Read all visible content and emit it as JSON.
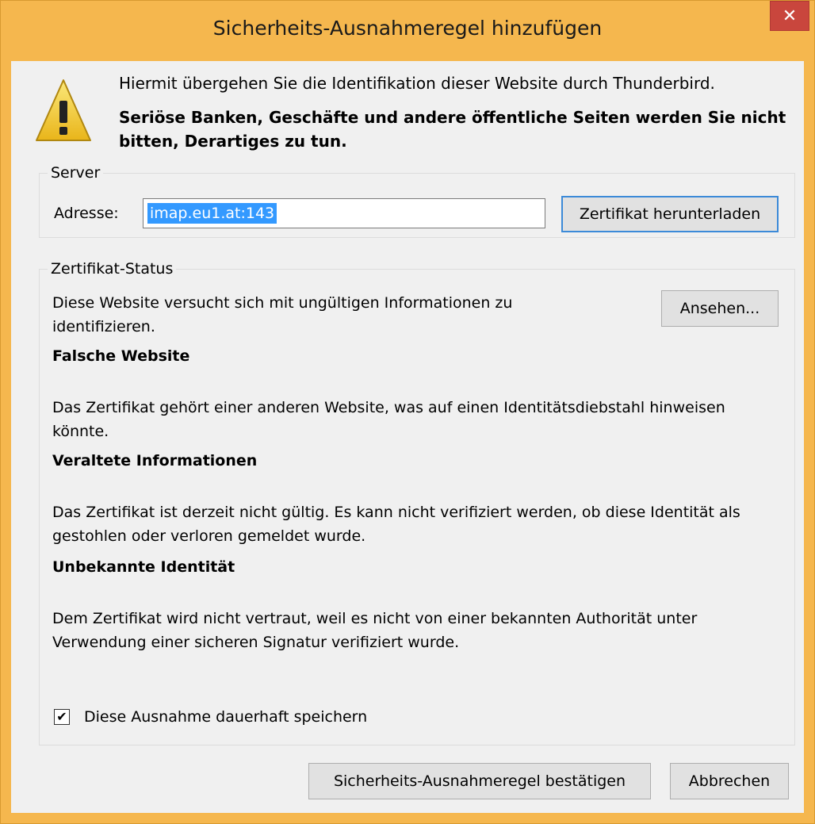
{
  "window": {
    "title": "Sicherheits-Ausnahmeregel hinzufügen",
    "close_glyph": "✕"
  },
  "intro": {
    "line1": "Hiermit übergehen Sie die Identifikation dieser Website durch Thunderbird.",
    "line2": "Seriöse Banken, Geschäfte und andere öffentliche Seiten werden Sie nicht bitten, Derartiges zu tun."
  },
  "server": {
    "legend": "Server",
    "address_label": "Adresse:",
    "address_value": "imap.eu1.at:143",
    "download_button": "Zertifikat herunterladen"
  },
  "status": {
    "legend": "Zertifikat-Status",
    "summary": "Diese Website versucht sich mit ungültigen Informationen zu identifizieren.",
    "view_button": "Ansehen...",
    "issues": [
      {
        "heading": "Falsche Website",
        "text": "Das Zertifikat gehört einer anderen Website, was auf einen Identitätsdiebstahl hinweisen könnte."
      },
      {
        "heading": "Veraltete Informationen",
        "text": "Das Zertifikat ist derzeit nicht gültig. Es kann nicht verifiziert werden, ob diese Identität als gestohlen oder verloren gemeldet wurde."
      },
      {
        "heading": "Unbekannte Identität",
        "text": "Dem Zertifikat wird nicht vertraut, weil es nicht von einer bekannten Authorität unter Verwendung einer sicheren Signatur verifiziert wurde."
      }
    ],
    "permanent_checkbox_label": "Diese Ausnahme dauerhaft speichern",
    "permanent_checked": true
  },
  "buttons": {
    "confirm": "Sicherheits-Ausnahmeregel bestätigen",
    "cancel": "Abbrechen"
  },
  "icons": {
    "warning": "warning-icon",
    "close": "close-icon",
    "checkmark": "checkmark-icon"
  },
  "colors": {
    "titlebar": "#f5b74e",
    "close_button": "#c9463d",
    "selection": "#3399ff",
    "focus_border": "#3c8ad8"
  }
}
